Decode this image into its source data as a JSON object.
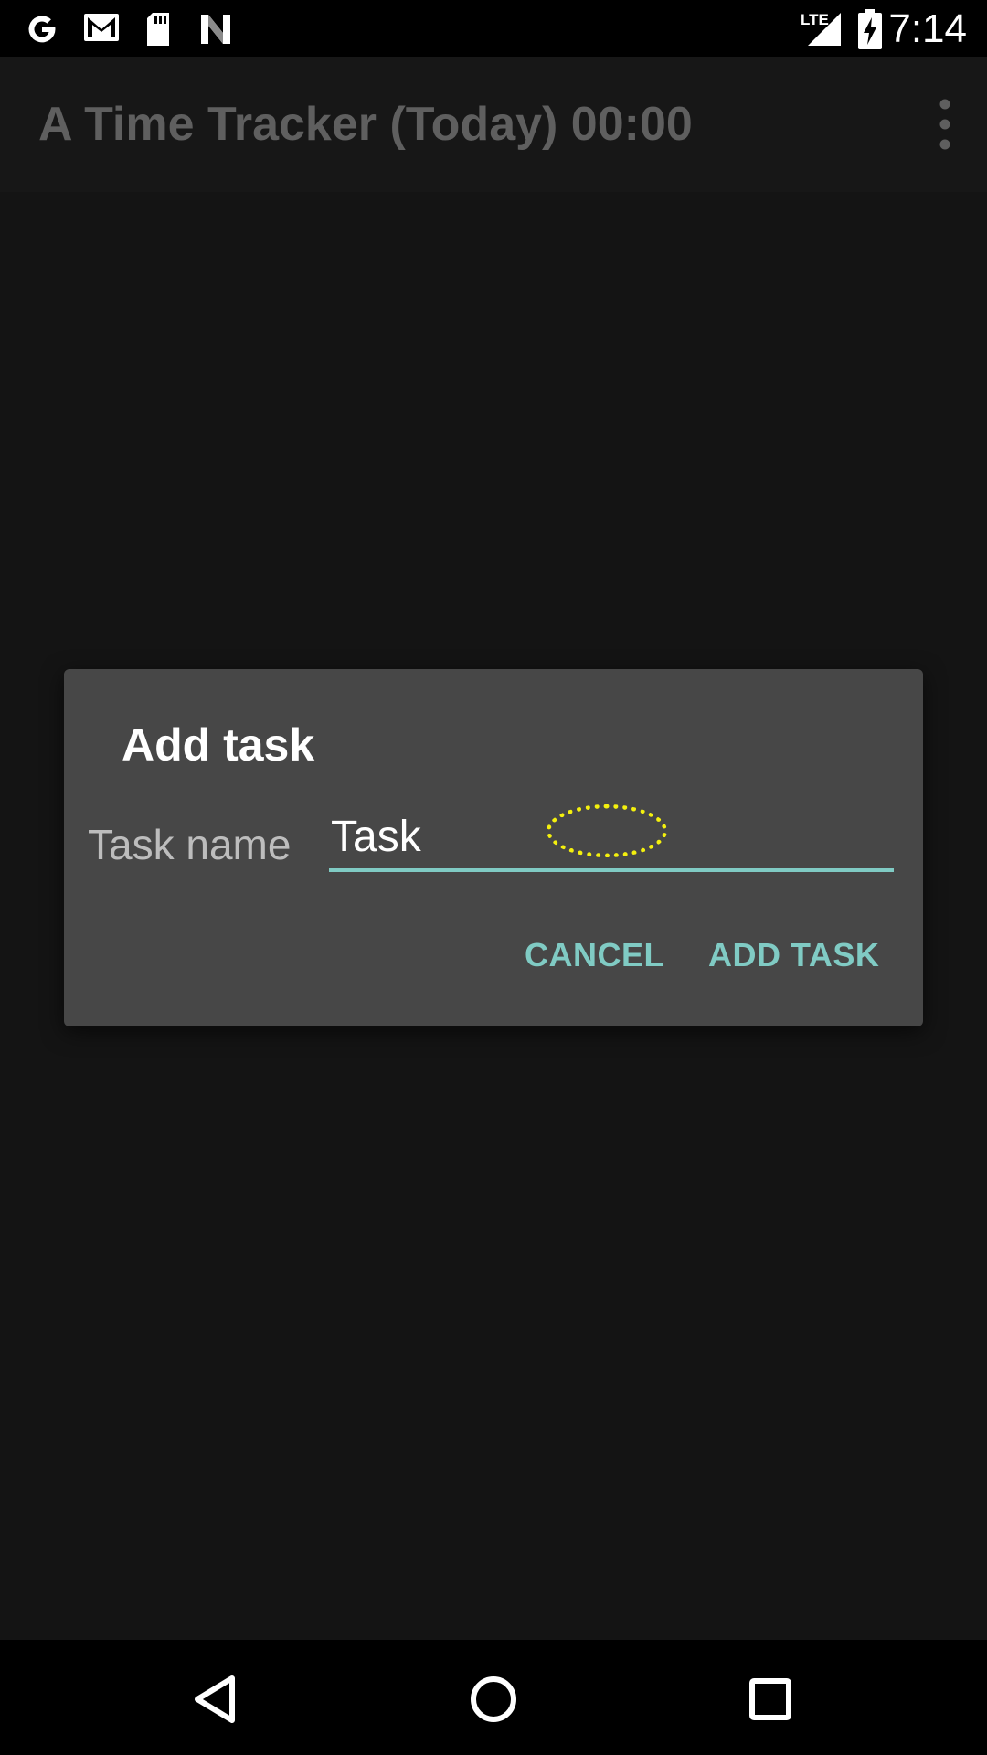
{
  "status_bar": {
    "time": "7:14",
    "network_label": "LTE",
    "icons": [
      "google-icon",
      "gmail-icon",
      "sd-card-icon",
      "n-app-icon",
      "lte-signal-icon",
      "battery-charging-icon"
    ]
  },
  "app_bar": {
    "title": "A Time Tracker (Today) 00:00",
    "overflow_icon": "more-vert-icon"
  },
  "dialog": {
    "title": "Add task",
    "field_label": "Task name",
    "input_value": "Task",
    "cancel_label": "CANCEL",
    "add_label": "ADD TASK"
  },
  "nav_bar": {
    "icons": [
      "back-icon",
      "home-icon",
      "recents-icon"
    ]
  },
  "colors": {
    "accent": "#80cbc4",
    "dialog_bg": "#474747",
    "background": "#141414",
    "tap_indicator": "#f4f00e"
  }
}
